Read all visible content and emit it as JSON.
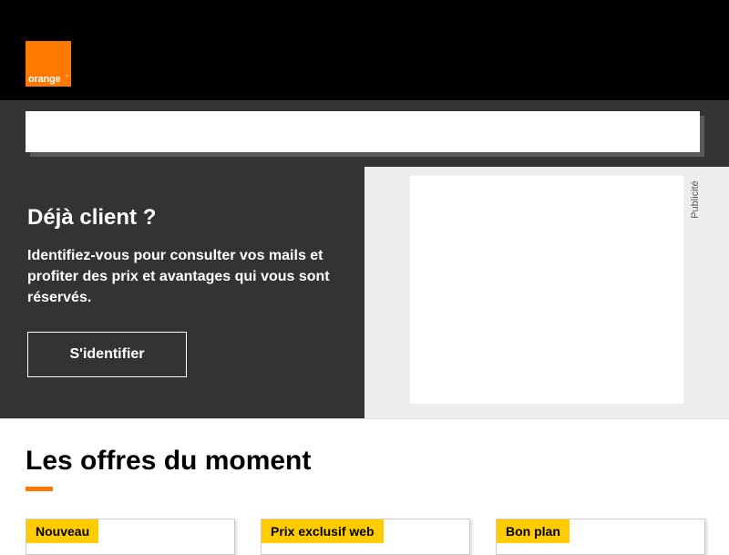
{
  "header": {
    "logo_text": "orange",
    "logo_tm": "™"
  },
  "search": {
    "value": "",
    "placeholder": ""
  },
  "login_promo": {
    "title": "Déjà client ?",
    "text": "Identifiez-vous pour consulter vos mails et profiter des prix et avantages qui vous sont réservés.",
    "button_label": "S'identifier"
  },
  "ad": {
    "label": "Publicité"
  },
  "offers": {
    "title": "Les offres du moment",
    "cards": [
      {
        "badge": "Nouveau"
      },
      {
        "badge": "Prix exclusif web"
      },
      {
        "badge": "Bon plan"
      }
    ]
  },
  "colors": {
    "brand_orange": "#ff7900",
    "header_black": "#000000",
    "panel_dark": "#333333",
    "badge_yellow": "#ffcc00",
    "ad_background": "#eeeeee"
  }
}
